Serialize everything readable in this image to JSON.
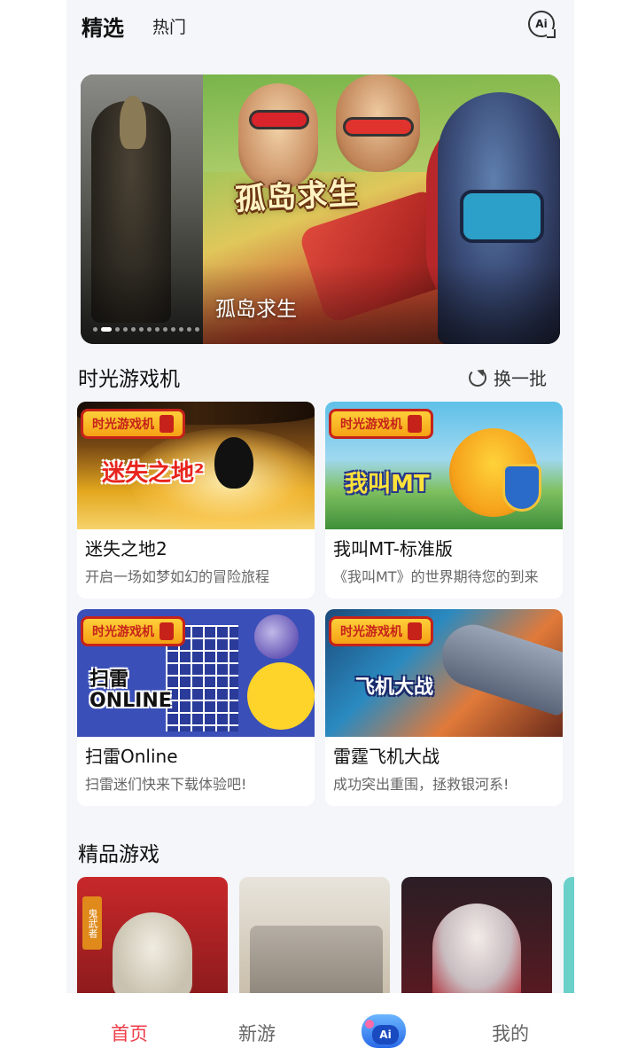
{
  "header": {
    "tab_selected": "精选",
    "tab_hot": "热门",
    "ai_label": "Ai"
  },
  "banner": {
    "title": "孤岛求生",
    "logo_text": "孤岛求生",
    "dot_count": 13,
    "active_dot": 1
  },
  "time_machine": {
    "title": "时光游戏机",
    "refresh_label": "换一批",
    "badge_text": "时光游戏机",
    "games": [
      {
        "name": "迷失之地2",
        "desc": "开启一场如梦如幻的冒险旅程",
        "logo": "迷失之地²"
      },
      {
        "name": "我叫MT-标准版",
        "desc": "《我叫MT》的世界期待您的到来",
        "logo": "我叫MT"
      },
      {
        "name": "扫雷Online",
        "desc": "扫雷迷们快来下载体验吧!",
        "logo": "扫雷 ONLINE"
      },
      {
        "name": "雷霆飞机大战",
        "desc": "成功突出重围，拯救银河系!",
        "logo": "飞机大战"
      }
    ]
  },
  "premium": {
    "title": "精品游戏",
    "tag_text": "鬼武者"
  },
  "bottom_nav": {
    "home": "首页",
    "new_games": "新游",
    "ai": "Ai",
    "mine": "我的"
  },
  "colors": {
    "accent_red": "#ef3d4a",
    "badge_yellow": "#f5a114",
    "background": "#f4f6f9"
  }
}
